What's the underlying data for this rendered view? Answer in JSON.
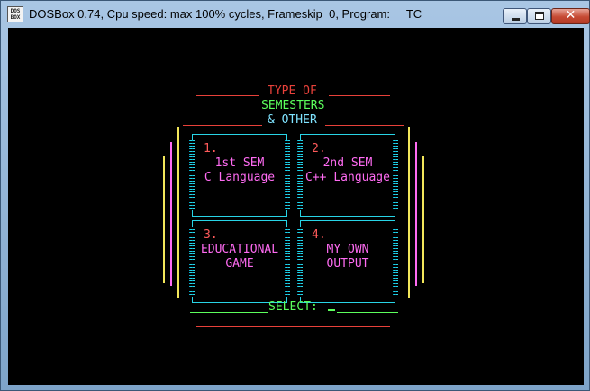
{
  "window": {
    "title": "DOSBox 0.74, Cpu speed: max 100% cycles, Frameskip  0, Program:     TC",
    "icon_text": "DOS BOX",
    "icons": {
      "minimize": "minimize-icon",
      "maximize": "maximize-icon",
      "close": "close-icon"
    }
  },
  "menu": {
    "heading_line1": "TYPE OF",
    "heading_line2": "SEMESTERS",
    "heading_line3": "& OTHER",
    "options": [
      {
        "number": "1.",
        "line1": "1st SEM",
        "line2": "C Language"
      },
      {
        "number": "2.",
        "line1": "2nd SEM",
        "line2": "C++ Language"
      },
      {
        "number": "3.",
        "line1": "EDUCATIONAL",
        "line2": "GAME"
      },
      {
        "number": "4.",
        "line1": "MY OWN",
        "line2": "OUTPUT"
      }
    ],
    "prompt": "SELECT:",
    "input_value": ""
  },
  "colors": {
    "red": "#e8413a",
    "green": "#5cff5c",
    "cyan": "#28d4e6",
    "magenta": "#ff6bf2",
    "yellow": "#f2e65a",
    "heading_blue": "#7fe3ff"
  }
}
